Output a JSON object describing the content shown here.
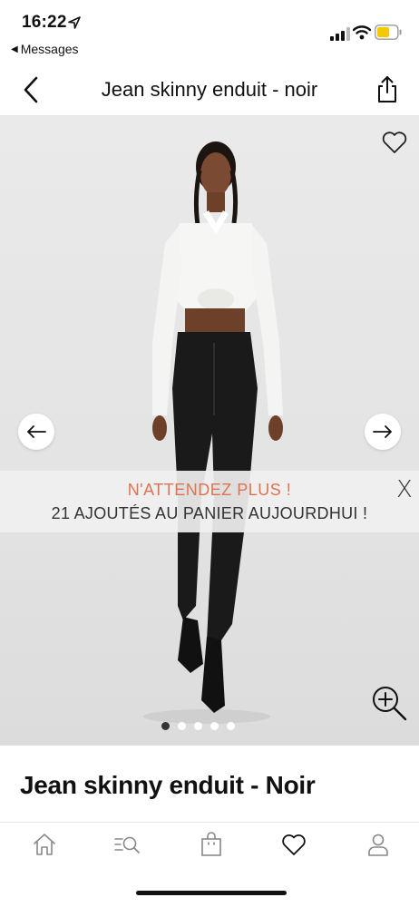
{
  "status_bar": {
    "time": "16:22",
    "back_app": "Messages"
  },
  "nav": {
    "title": "Jean skinny enduit - noir"
  },
  "gallery": {
    "image_count": 5,
    "active_index": 0
  },
  "promo": {
    "title": "N'ATTENDEZ PLUS !",
    "subtitle": "21 AJOUTÉS AU PANIER AUJOURDHUI !",
    "close_label": "X"
  },
  "product": {
    "name": "Jean skinny enduit - Noir"
  },
  "colors": {
    "accent": "#e0734f",
    "text": "#111111",
    "battery": "#f5c800"
  },
  "tabs": [
    {
      "icon": "home-icon"
    },
    {
      "icon": "search-icon"
    },
    {
      "icon": "bag-icon"
    },
    {
      "icon": "heart-icon"
    },
    {
      "icon": "account-icon"
    }
  ]
}
